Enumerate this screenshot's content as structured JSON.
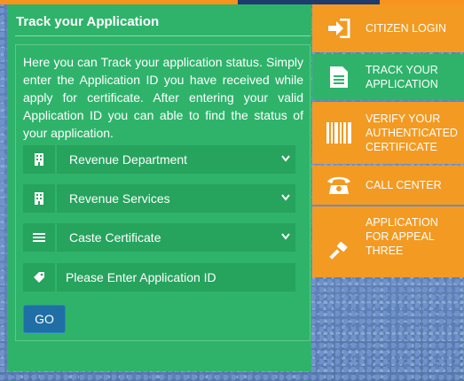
{
  "panel": {
    "title": "Track your Application",
    "intro": "Here you can Track your application status. Simply enter the Application ID you have received while apply for certificate. After entering your valid Application ID you can able to find the status of your application."
  },
  "form": {
    "department": {
      "value": "Revenue Department",
      "icon": "building-icon"
    },
    "service": {
      "value": "Revenue Services",
      "icon": "building-icon"
    },
    "certificate": {
      "value": "Caste Certificate",
      "icon": "list-icon"
    },
    "application_id": {
      "placeholder": "Please Enter Application ID",
      "icon": "tag-icon"
    },
    "go_label": "GO"
  },
  "side_menu": [
    {
      "label": "CITIZEN LOGIN",
      "icon": "login-icon"
    },
    {
      "label": "TRACK YOUR APPLICATION",
      "icon": "document-icon"
    },
    {
      "label": "VERIFY YOUR AUTHENTICATED CERTIFICATE",
      "icon": "barcode-icon"
    },
    {
      "label": "CALL CENTER",
      "icon": "phone-icon"
    },
    {
      "label": "APPLICATION FOR APPEAL THREE",
      "icon": "gavel-icon"
    }
  ],
  "colors": {
    "orange": "#f39a22",
    "green": "#2fb36b",
    "field_green": "#26a35d",
    "go_blue": "#1f6fa6"
  }
}
